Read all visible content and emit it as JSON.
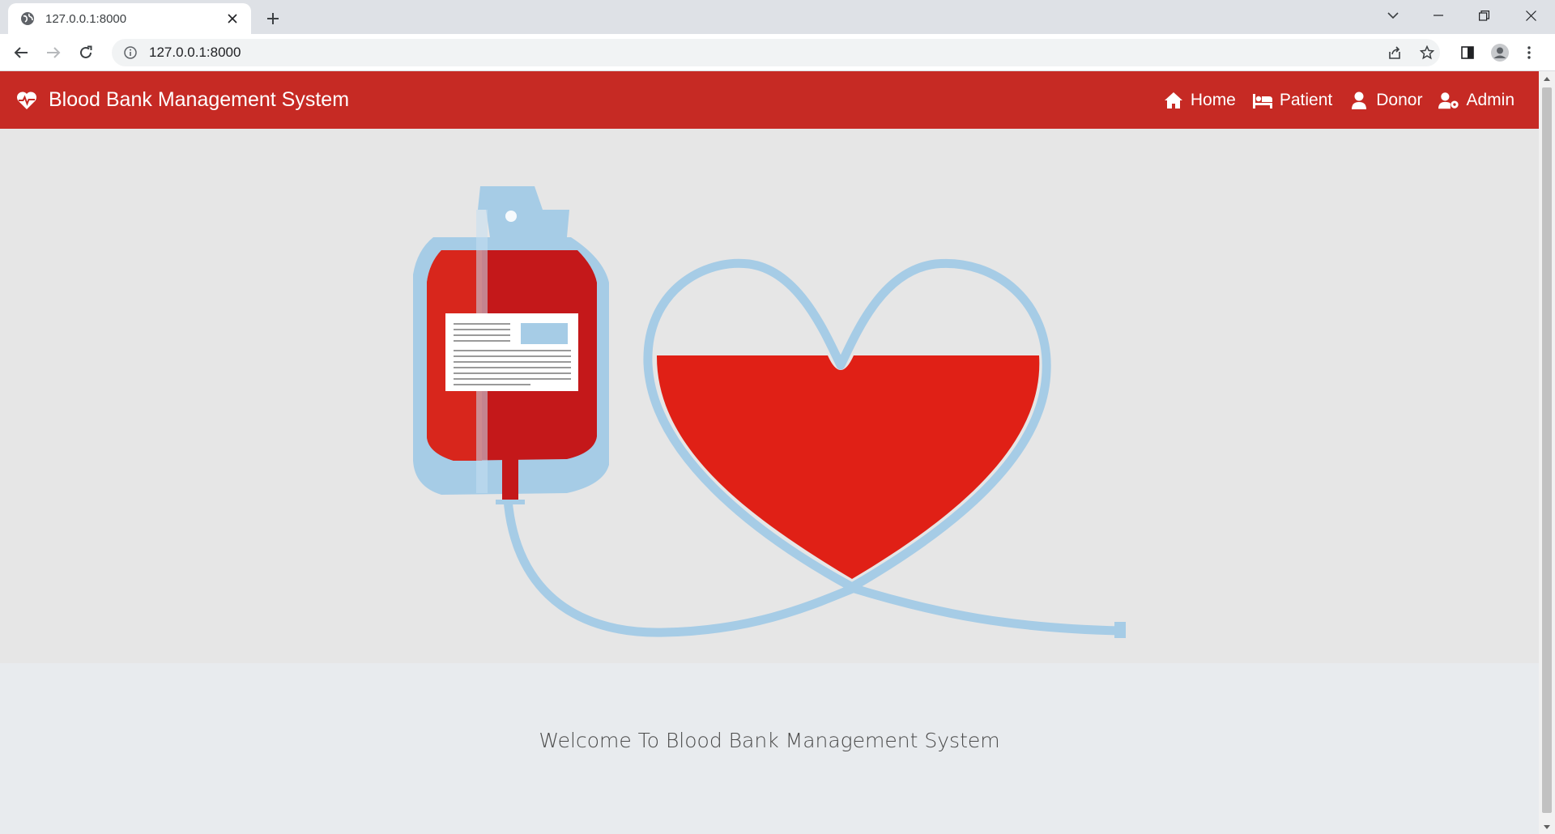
{
  "browser": {
    "tab_title": "127.0.0.1:8000",
    "url": "127.0.0.1:8000"
  },
  "navbar": {
    "brand": "Blood Bank Management System",
    "links": [
      {
        "label": "Home",
        "icon": "home-icon"
      },
      {
        "label": "Patient",
        "icon": "bed-icon"
      },
      {
        "label": "Donor",
        "icon": "user-icon"
      },
      {
        "label": "Admin",
        "icon": "user-cog-icon"
      }
    ]
  },
  "colors": {
    "navbar": "#c62a24",
    "blood": "#e02016",
    "tube": "#a6cce6",
    "hero_bg": "#e6e6e6",
    "page_bg": "#e8ebee"
  },
  "main": {
    "welcome_text": "Welcome To Blood Bank Management System"
  }
}
